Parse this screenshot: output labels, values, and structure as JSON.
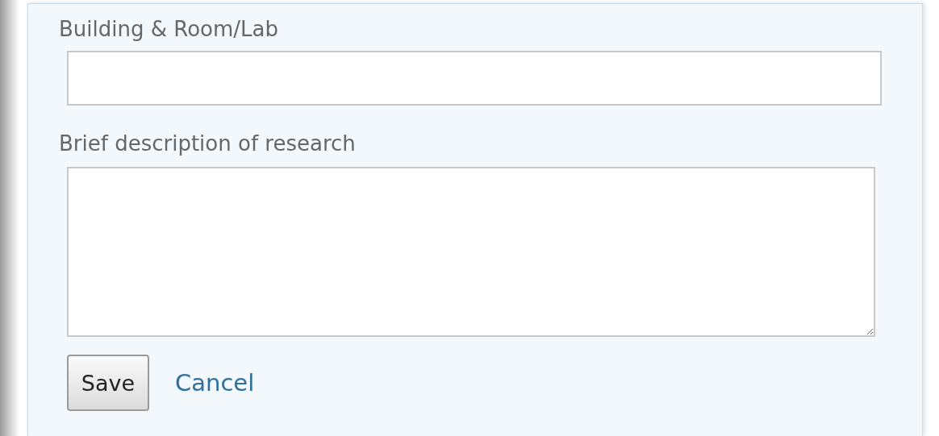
{
  "fields": [
    {
      "label": "Building & Room/Lab",
      "kind": "input"
    },
    {
      "label": "Brief description of research",
      "kind": "textarea"
    }
  ],
  "actions": {
    "save": "Save",
    "cancel": "Cancel"
  }
}
